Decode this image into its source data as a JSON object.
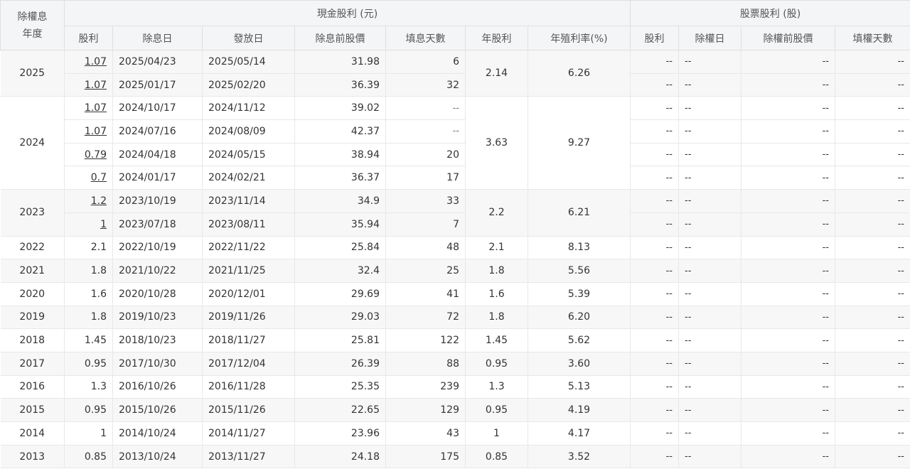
{
  "header": {
    "year_col": "除權息\n年度",
    "year_col_line1": "除權息",
    "year_col_line2": "年度",
    "cash_group": "現金股利 (元)",
    "stock_group": "股票股利 (股)",
    "cash_cols": [
      "股利",
      "除息日",
      "發放日",
      "除息前股價",
      "填息天數",
      "年股利",
      "年殖利率(%)"
    ],
    "stock_cols": [
      "股利",
      "除權日",
      "除權前股價",
      "填權天數"
    ]
  },
  "empty": "--",
  "groups": [
    {
      "year": "2025",
      "annual": "2.14",
      "yield": "6.26",
      "rows": [
        {
          "div": "1.07",
          "ex": "2025/04/23",
          "pay": "2025/05/14",
          "price": "31.98",
          "days": "6"
        },
        {
          "div": "1.07",
          "ex": "2025/01/17",
          "pay": "2025/02/20",
          "price": "36.39",
          "days": "32"
        }
      ]
    },
    {
      "year": "2024",
      "annual": "3.63",
      "yield": "9.27",
      "rows": [
        {
          "div": "1.07",
          "ex": "2024/10/17",
          "pay": "2024/11/12",
          "price": "39.02",
          "days": "--"
        },
        {
          "div": "1.07",
          "ex": "2024/07/16",
          "pay": "2024/08/09",
          "price": "42.37",
          "days": "--"
        },
        {
          "div": "0.79",
          "ex": "2024/04/18",
          "pay": "2024/05/15",
          "price": "38.94",
          "days": "20"
        },
        {
          "div": "0.7",
          "ex": "2024/01/17",
          "pay": "2024/02/21",
          "price": "36.37",
          "days": "17"
        }
      ]
    },
    {
      "year": "2023",
      "annual": "2.2",
      "yield": "6.21",
      "rows": [
        {
          "div": "1.2",
          "ex": "2023/10/19",
          "pay": "2023/11/14",
          "price": "34.9",
          "days": "33"
        },
        {
          "div": "1",
          "ex": "2023/07/18",
          "pay": "2023/08/11",
          "price": "35.94",
          "days": "7"
        }
      ]
    }
  ],
  "singles": [
    {
      "year": "2022",
      "div": "2.1",
      "ex": "2022/10/19",
      "pay": "2022/11/22",
      "price": "25.84",
      "days": "48",
      "annual": "2.1",
      "yield": "8.13"
    },
    {
      "year": "2021",
      "div": "1.8",
      "ex": "2021/10/22",
      "pay": "2021/11/25",
      "price": "32.4",
      "days": "25",
      "annual": "1.8",
      "yield": "5.56"
    },
    {
      "year": "2020",
      "div": "1.6",
      "ex": "2020/10/28",
      "pay": "2020/12/01",
      "price": "29.69",
      "days": "41",
      "annual": "1.6",
      "yield": "5.39"
    },
    {
      "year": "2019",
      "div": "1.8",
      "ex": "2019/10/23",
      "pay": "2019/11/26",
      "price": "29.03",
      "days": "72",
      "annual": "1.8",
      "yield": "6.20"
    },
    {
      "year": "2018",
      "div": "1.45",
      "ex": "2018/10/23",
      "pay": "2018/11/27",
      "price": "25.81",
      "days": "122",
      "annual": "1.45",
      "yield": "5.62"
    },
    {
      "year": "2017",
      "div": "0.95",
      "ex": "2017/10/30",
      "pay": "2017/12/04",
      "price": "26.39",
      "days": "88",
      "annual": "0.95",
      "yield": "3.60"
    },
    {
      "year": "2016",
      "div": "1.3",
      "ex": "2016/10/26",
      "pay": "2016/11/28",
      "price": "25.35",
      "days": "239",
      "annual": "1.3",
      "yield": "5.13"
    },
    {
      "year": "2015",
      "div": "0.95",
      "ex": "2015/10/26",
      "pay": "2015/11/26",
      "price": "22.65",
      "days": "129",
      "annual": "0.95",
      "yield": "4.19"
    },
    {
      "year": "2014",
      "div": "1",
      "ex": "2014/10/24",
      "pay": "2014/11/27",
      "price": "23.96",
      "days": "43",
      "annual": "1",
      "yield": "4.17"
    },
    {
      "year": "2013",
      "div": "0.85",
      "ex": "2013/10/24",
      "pay": "2013/11/27",
      "price": "24.18",
      "days": "175",
      "annual": "0.85",
      "yield": "3.52"
    }
  ]
}
